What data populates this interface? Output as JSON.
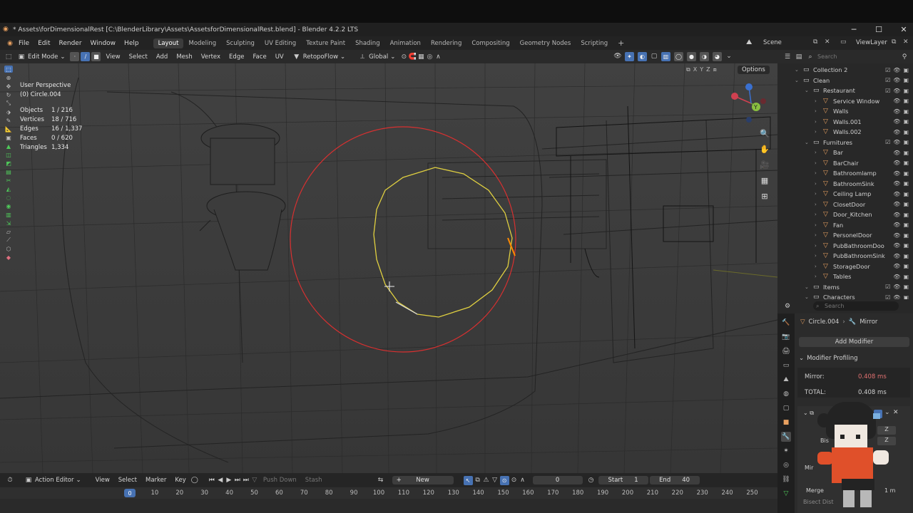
{
  "window": {
    "title": "* Assets\\forDimensionalRest [C:\\BlenderLibrary\\Assets\\AssetsforDimensionalRest.blend] - Blender 4.2.2 LTS"
  },
  "menu": [
    "File",
    "Edit",
    "Render",
    "Window",
    "Help"
  ],
  "workspaces": [
    {
      "label": "Layout",
      "active": true
    },
    {
      "label": "Modeling"
    },
    {
      "label": "Sculpting"
    },
    {
      "label": "UV Editing"
    },
    {
      "label": "Texture Paint"
    },
    {
      "label": "Shading"
    },
    {
      "label": "Animation"
    },
    {
      "label": "Rendering"
    },
    {
      "label": "Compositing"
    },
    {
      "label": "Geometry Nodes"
    },
    {
      "label": "Scripting"
    }
  ],
  "scene": {
    "label": "Scene",
    "view_layer": "ViewLayer"
  },
  "viewport_header": {
    "mode": "Edit Mode",
    "menus": [
      "View",
      "Select",
      "Add",
      "Mesh",
      "Vertex",
      "Edge",
      "Face",
      "UV"
    ],
    "addon": "RetopoFlow",
    "orientation": "Global",
    "options": "Options"
  },
  "viewport": {
    "perspective": "User Perspective",
    "object_name": "(0) Circle.004",
    "stats": [
      {
        "label": "Objects",
        "value": "1 / 216"
      },
      {
        "label": "Vertices",
        "value": "18 / 716"
      },
      {
        "label": "Edges",
        "value": "16 / 1,337"
      },
      {
        "label": "Faces",
        "value": "0 / 620"
      },
      {
        "label": "Triangles",
        "value": "1,334"
      }
    ],
    "gizmo": {
      "x": "X",
      "y": "Y",
      "z": "Z"
    }
  },
  "outliner": {
    "search_placeholder": "Search",
    "rows": [
      {
        "label": "Collection 2",
        "type": "collection",
        "indent": 1
      },
      {
        "label": "Clean",
        "type": "collection",
        "indent": 1
      },
      {
        "label": "Restaurant",
        "type": "collection",
        "indent": 2
      },
      {
        "label": "Service Window",
        "type": "object",
        "indent": 3
      },
      {
        "label": "Walls",
        "type": "object",
        "indent": 3
      },
      {
        "label": "Walls.001",
        "type": "object",
        "indent": 3
      },
      {
        "label": "Walls.002",
        "type": "object",
        "indent": 3
      },
      {
        "label": "Furnitures",
        "type": "collection",
        "indent": 2
      },
      {
        "label": "Bar",
        "type": "object",
        "indent": 3
      },
      {
        "label": "BarChair",
        "type": "object",
        "indent": 3
      },
      {
        "label": "Bathroomlamp",
        "type": "object",
        "indent": 3
      },
      {
        "label": "BathroomSink",
        "type": "object",
        "indent": 3
      },
      {
        "label": "Ceiling Lamp",
        "type": "object",
        "indent": 3
      },
      {
        "label": "ClosetDoor",
        "type": "object",
        "indent": 3
      },
      {
        "label": "Door_Kitchen",
        "type": "object",
        "indent": 3
      },
      {
        "label": "Fan",
        "type": "object",
        "indent": 3
      },
      {
        "label": "PersonelDoor",
        "type": "object",
        "indent": 3
      },
      {
        "label": "PubBathroomDoo",
        "type": "object",
        "indent": 3
      },
      {
        "label": "PubBathroomSink",
        "type": "object",
        "indent": 3
      },
      {
        "label": "StorageDoor",
        "type": "object",
        "indent": 3
      },
      {
        "label": "Tables",
        "type": "object",
        "indent": 3
      },
      {
        "label": "Items",
        "type": "collection",
        "indent": 2
      },
      {
        "label": "Characters",
        "type": "collection",
        "indent": 2
      }
    ]
  },
  "properties": {
    "search_placeholder": "Search",
    "breadcrumb_object": "Circle.004",
    "breadcrumb_modifier": "Mirror",
    "add_modifier": "Add Modifier",
    "panel_title": "Modifier Profiling",
    "profiling": [
      {
        "label": "Mirror:",
        "value": "0.408 ms"
      },
      {
        "label": "TOTAL:",
        "value": "0.408 ms"
      }
    ],
    "partial_labels": {
      "axis": "A",
      "bisect": "Bis",
      "mirror": "Mir",
      "merge": "Merge",
      "bisect_dist": "Bisect Dist",
      "z1": "Z",
      "z2": "Z",
      "merge_val": "1 m"
    }
  },
  "timeline": {
    "editor": "Action Editor",
    "menus": [
      "View",
      "Select",
      "Marker",
      "Key"
    ],
    "push_down": "Push Down",
    "stash": "Stash",
    "new_label": "New",
    "current_frame": "0",
    "start_label": "Start",
    "start_value": "1",
    "end_label": "End",
    "end_value": "40",
    "ticks": [
      "0",
      "10",
      "20",
      "30",
      "40",
      "50",
      "60",
      "70",
      "80",
      "90",
      "100",
      "110",
      "120",
      "130",
      "140",
      "150",
      "160",
      "170",
      "180",
      "190",
      "200",
      "210",
      "220",
      "230",
      "240",
      "250"
    ]
  },
  "colors": {
    "accent": "#4772b3",
    "selection_yellow": "#e0d040",
    "brush_red": "#d83030",
    "object_orange": "#e8a060",
    "mesh_green": "#4fc85a"
  }
}
